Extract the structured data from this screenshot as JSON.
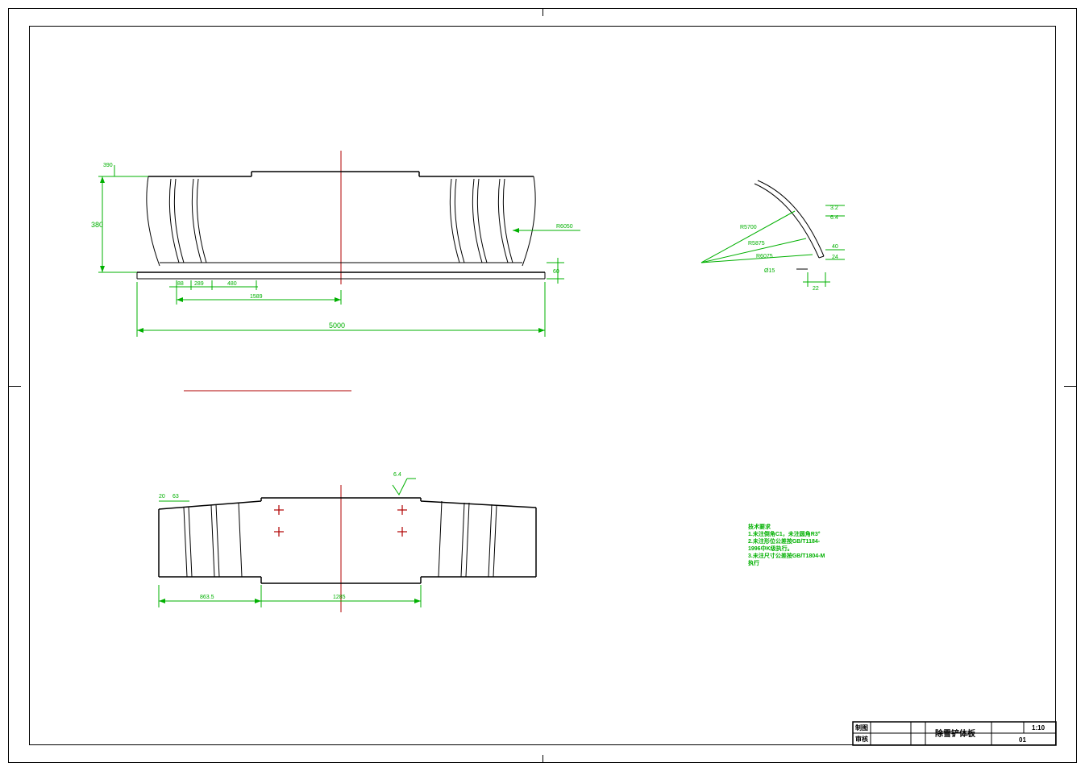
{
  "dims": {
    "d1": "390",
    "d2": "380",
    "d3": "60",
    "d4": "88",
    "d5": "289",
    "d6": "480",
    "d7": "1589",
    "d8": "5000",
    "d9": "R6050",
    "d10": "20",
    "d11": "63",
    "d12": "863.5",
    "d13": "1285",
    "d14": "6.4",
    "sv1": "3.2",
    "sv2": "6.4",
    "sv3": "R5700",
    "sv4": "R5875",
    "sv5": "R6075",
    "sv6": "Ø15",
    "sv7": "24",
    "sv8": "40",
    "sv9": "22"
  },
  "notes": {
    "title": "技术要求",
    "l1": "1.未注倒角C1，未注圆角R3°",
    "l2": "2.未注形位公差按GB/T1184-",
    "l3": "1996中K级执行。",
    "l4": "3.未注尺寸公差按GB/T1804-M",
    "l5": "执行"
  },
  "titleblock": {
    "r1c1": "制图",
    "r2c1": "审核",
    "title": "除雪铲体板",
    "scale": "1:10",
    "sheet": "01"
  }
}
